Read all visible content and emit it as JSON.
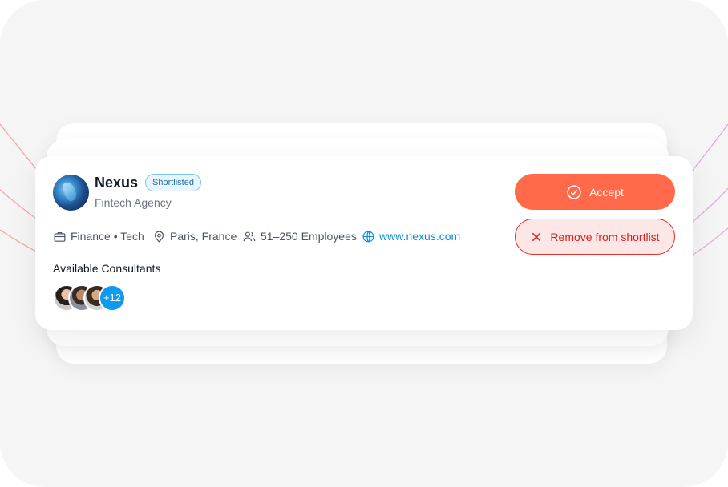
{
  "company": {
    "name": "Nexus",
    "badge": "Shortlisted",
    "subtitle": "Fintech Agency",
    "logo_icon": "nexus-logo"
  },
  "meta": {
    "industry": "Finance • Tech",
    "location": "Paris, France",
    "size": "51–250 Employees",
    "website": "www.nexus.com"
  },
  "consultants": {
    "label": "Available Consultants",
    "more_count": "+12"
  },
  "actions": {
    "accept_label": "Accept",
    "remove_label": "Remove from shortlist"
  },
  "colors": {
    "accent": "#ff6a4a",
    "link": "#0a8ed8",
    "danger": "#d91f1a",
    "badge_border": "#7cc4ee"
  }
}
